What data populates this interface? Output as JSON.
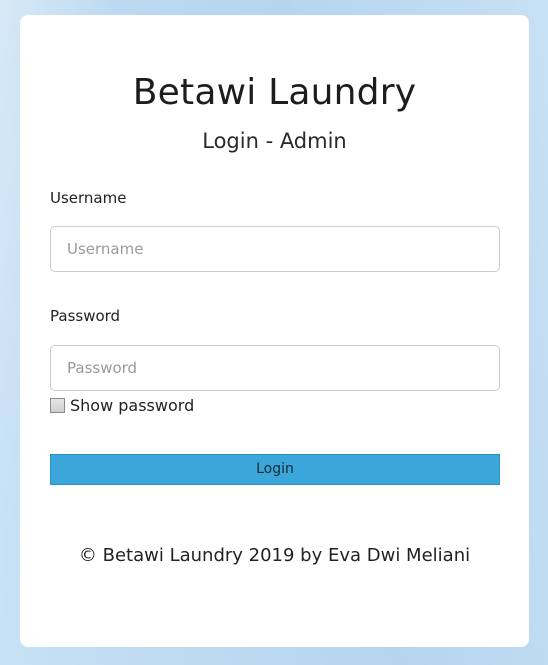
{
  "app": {
    "title": "Betawi Laundry",
    "subtitle": "Login - Admin"
  },
  "form": {
    "username_label": "Username",
    "username_placeholder": "Username",
    "username_value": "",
    "password_label": "Password",
    "password_placeholder": "Password",
    "password_value": "",
    "show_password_label": "Show password",
    "show_password_checked": false,
    "login_label": "Login"
  },
  "footer": {
    "text": "© Betawi Laundry 2019 by Eva Dwi Meliani"
  },
  "colors": {
    "accent": "#3aa6d9",
    "background": "#bcd9f0"
  }
}
